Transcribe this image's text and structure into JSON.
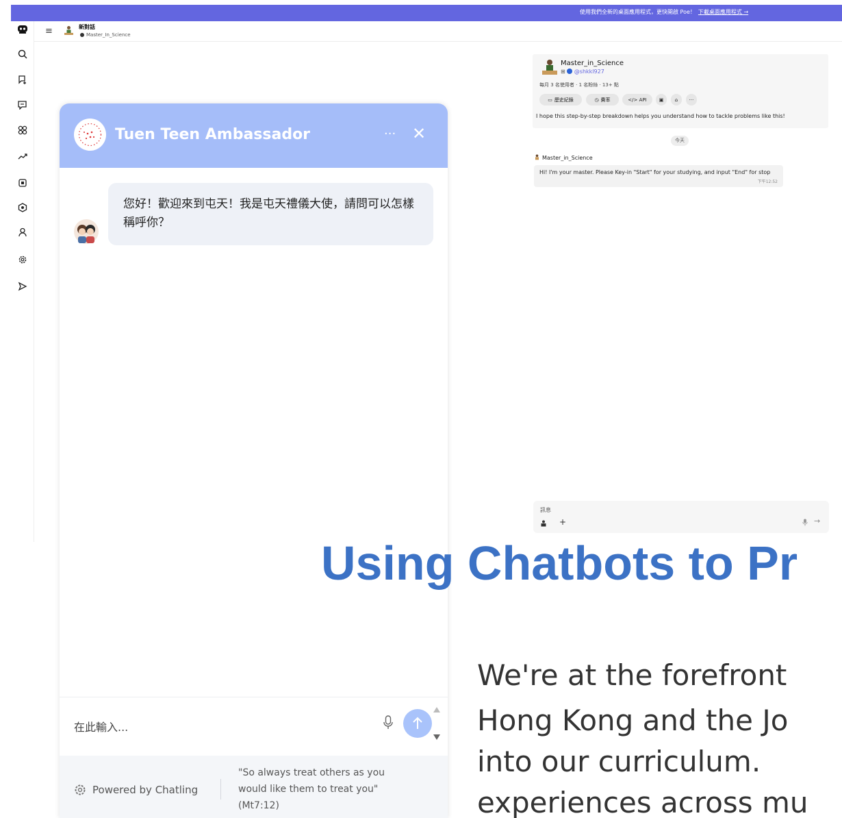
{
  "banner": {
    "text": "使用我們全新的桌面應用程式，更快開啟 Poe！",
    "link": "下載桌面應用程式 →"
  },
  "header": {
    "title": "新對話",
    "subtitle": "Master_In_Science"
  },
  "sidebar_icons": [
    "poe-logo-icon",
    "search-icon",
    "new-chat-icon",
    "chats-icon",
    "apps-icon",
    "trending-icon",
    "bots-icon",
    "creators-icon",
    "profile-icon",
    "settings-icon",
    "send-icon"
  ],
  "widget": {
    "title": "Tuen Teen Ambassador",
    "more": "···",
    "close": "✕",
    "message": "您好！歡迎來到屯天！我是屯天禮儀大使，請問可以怎樣稱呼你？",
    "input_placeholder": "在此輸入...",
    "powered_by": "Powered by Chatling",
    "quote": "\"So always treat others as you would like them to treat you\" (Mt7:12)",
    "header_color": "#a5bdf9",
    "send_color": "#a9c3fb"
  },
  "poe": {
    "bot_name": "Master_in_Science",
    "bot_handle": "@shkkl927",
    "stats": "每月 3 名使用者 · 1 名粉絲 · 13+ 點",
    "pills": [
      "歷史紀錄",
      "費率",
      "</> API",
      "",
      "",
      "···"
    ],
    "description": "I hope this step-by-step breakdown helps you understand how to tackle problems like this!",
    "today": "今天",
    "msg_author": "Master_in_Science",
    "msg_text": "Hi! I'm your master. Please Key-in \"Start\" for your studying, and input \"End\" for stop",
    "msg_time": "下午12:52",
    "input_placeholder": "訊息",
    "plus": "+",
    "send": "→",
    "accent": "#6366e0"
  },
  "slide": {
    "headline": "Using Chatbots to Pr",
    "body": [
      "We're at the forefront",
      "Hong Kong and the Jo",
      "into our curriculum.",
      "experiences across mu"
    ],
    "headline_color": "#3c72c5"
  }
}
